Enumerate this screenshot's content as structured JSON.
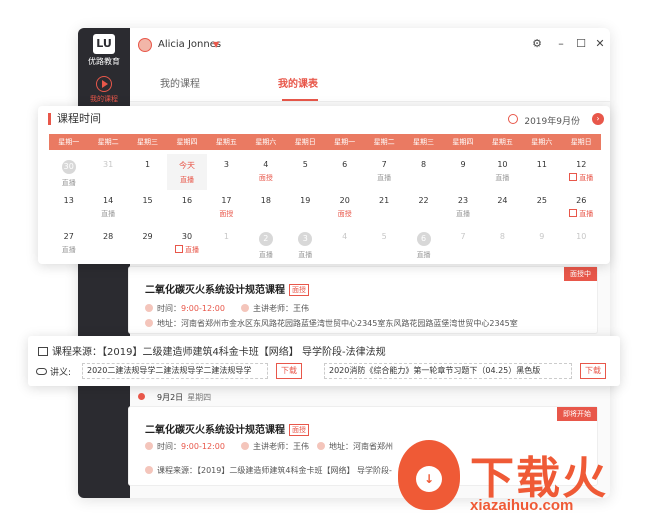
{
  "app": {
    "logo_text": "优路教育",
    "nav_label": "我的课程",
    "user": "Alicia Jonnes"
  },
  "controls": {
    "settings": "⚙",
    "minimize": "–",
    "maximize": "☐",
    "close": "✕"
  },
  "tabs": [
    {
      "label": "我的课程"
    },
    {
      "label": "我的课表"
    }
  ],
  "calendar": {
    "title": "课程时间",
    "month": "2019年9月份",
    "weekdays": [
      "星期一",
      "星期二",
      "星期三",
      "星期四",
      "星期五",
      "星期六",
      "星期日",
      "星期一",
      "星期二",
      "星期三",
      "星期四",
      "星期五",
      "星期六",
      "星期日"
    ],
    "days": [
      {
        "n": "30",
        "muted": true,
        "circle": true,
        "tag": "直播"
      },
      {
        "n": "31",
        "muted": true
      },
      {
        "n": "1"
      },
      {
        "n": "今天",
        "today": true,
        "tag": "直播",
        "tag_red": true
      },
      {
        "n": "3"
      },
      {
        "n": "4",
        "tag": "面授",
        "tag_red": true
      },
      {
        "n": "5"
      },
      {
        "n": "6"
      },
      {
        "n": "7",
        "tag": "直播"
      },
      {
        "n": "8"
      },
      {
        "n": "9"
      },
      {
        "n": "10",
        "tag": "直播"
      },
      {
        "n": "11"
      },
      {
        "n": "12",
        "tag": "直播",
        "tag_icon": true
      },
      {
        "n": "13"
      },
      {
        "n": "14",
        "tag": "直播"
      },
      {
        "n": "15"
      },
      {
        "n": "16"
      },
      {
        "n": "17",
        "tag": "面授",
        "tag_red": true
      },
      {
        "n": "18"
      },
      {
        "n": "19"
      },
      {
        "n": "20",
        "tag": "面授",
        "tag_red": true
      },
      {
        "n": "21"
      },
      {
        "n": "22"
      },
      {
        "n": "23",
        "tag": "直播"
      },
      {
        "n": "24"
      },
      {
        "n": "25"
      },
      {
        "n": "26",
        "tag": "直播",
        "tag_icon": true
      },
      {
        "n": "27",
        "tag": "直播"
      },
      {
        "n": "28"
      },
      {
        "n": "29"
      },
      {
        "n": "30",
        "tag": "直播",
        "tag_icon": true
      },
      {
        "n": "1",
        "muted": true
      },
      {
        "n": "2",
        "muted": true,
        "circle": true,
        "tag": "直播"
      },
      {
        "n": "3",
        "muted": true,
        "circle": true,
        "tag": "直播"
      },
      {
        "n": "4",
        "muted": true
      },
      {
        "n": "5",
        "muted": true
      },
      {
        "n": "6",
        "muted": true,
        "circle": true,
        "tag": "直播"
      },
      {
        "n": "7",
        "muted": true
      },
      {
        "n": "8",
        "muted": true
      },
      {
        "n": "9",
        "muted": true
      },
      {
        "n": "10",
        "muted": true
      }
    ]
  },
  "course1": {
    "title": "二氧化碳灭火系统设计规范课程",
    "badge": "面授",
    "ribbon": "面授中",
    "time_label": "时间：",
    "time": "9:00-12:00",
    "teacher_label": "主讲老师：",
    "teacher": "王伟",
    "address_label": "地址：",
    "address": "河南省郑州市金水区东风路花园路蓝堡湾世贸中心2345室东风路花园路蓝堡湾世贸中心2345室"
  },
  "source": {
    "line": "课程来源：【2019】二级建造师建筑4科金卡班【网络】  导学阶段-法律法规",
    "handout_label": "讲义:",
    "file1": "2020二建法规导学二建法规导学二建法规导学",
    "file2": "2020消防《综合能力》第一轮章节习题下（04.25）黑色版",
    "download": "下载"
  },
  "date_row": {
    "date": "9月2日",
    "weekday": "星期四"
  },
  "course2": {
    "title": "二氧化碳灭火系统设计规范课程",
    "badge": "面授",
    "ribbon": "即将开始",
    "time_label": "时间：",
    "time": "9:00-12:00",
    "teacher_label": "主讲老师：",
    "teacher": "王伟",
    "address_label": "地址：",
    "address": "河南省郑州",
    "source": "课程来源：【2019】二级建造师建筑4科金卡班【网络】  导学阶段-"
  },
  "watermark": {
    "text": "下载火",
    "url": "xiazaihuo.com"
  }
}
